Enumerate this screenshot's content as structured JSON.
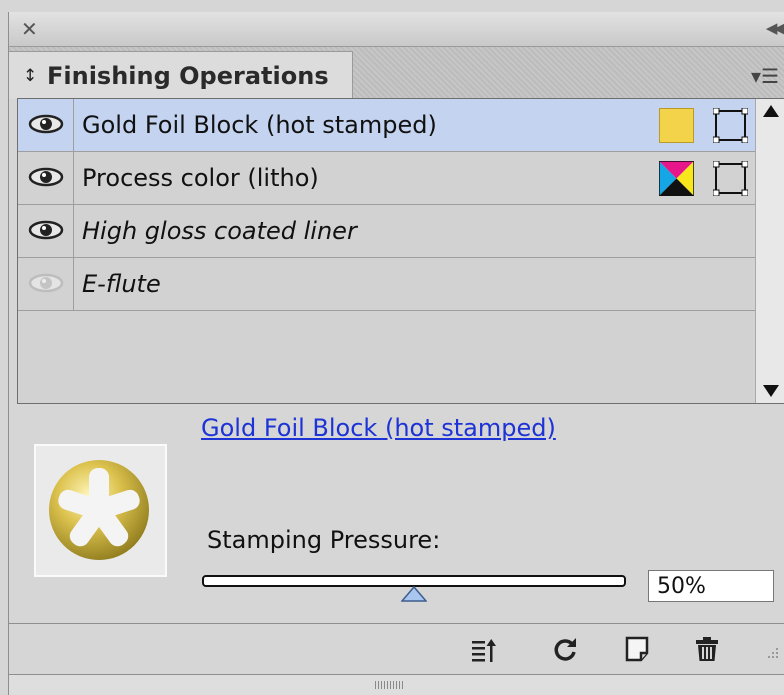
{
  "panel": {
    "title": "Finishing Operations",
    "tab_caret": "↕"
  },
  "list": {
    "items": [
      {
        "label": "Gold Foil Block (hot stamped)",
        "italic": false,
        "visible": true,
        "selected": true,
        "swatch": "yellow"
      },
      {
        "label": "Process color (litho)",
        "italic": false,
        "visible": true,
        "selected": false,
        "swatch": "cmyk"
      },
      {
        "label": "High gloss coated liner",
        "italic": true,
        "visible": true,
        "selected": false,
        "swatch": null
      },
      {
        "label": "E-flute",
        "italic": true,
        "visible": false,
        "selected": false,
        "swatch": null
      }
    ]
  },
  "detail": {
    "link_text": "Gold Foil Block (hot stamped)",
    "pressure_label": "Stamping Pressure:",
    "pressure_value": "50%",
    "pressure_fraction": 0.5
  },
  "footer": {
    "buttons": [
      "move-to-top-icon",
      "refresh-icon",
      "new-item-icon",
      "trash-icon"
    ]
  },
  "colors": {
    "selection": "#c3d3f0",
    "swatch_yellow": "#f2d34a",
    "link": "#1d33d6"
  }
}
